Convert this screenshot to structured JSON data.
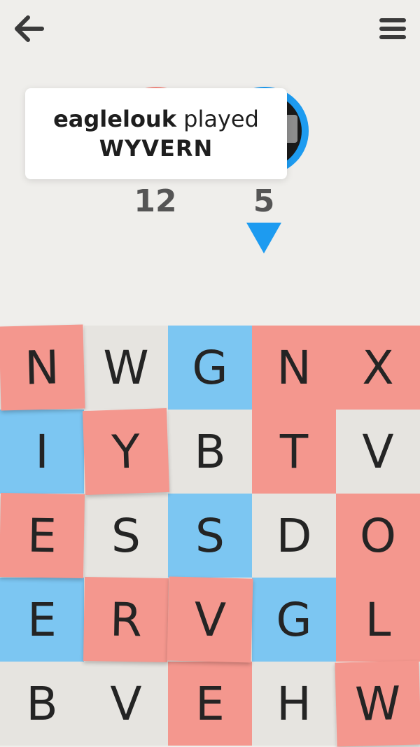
{
  "header": {
    "back_icon": "arrow-left-icon",
    "menu_icon": "hamburger-menu-icon"
  },
  "toast": {
    "player": "eaglelouk",
    "verb": "played",
    "word": "WYVERN"
  },
  "scores": {
    "left": "12",
    "right": "5"
  },
  "colors": {
    "red": "#f4978e",
    "blue": "#7cc6f2",
    "neutral": "#e6e4e0",
    "accent_blue": "#1d9bf0",
    "accent_red": "#f28b82"
  },
  "board": {
    "rows": [
      [
        {
          "letter": "N",
          "owner": "red"
        },
        {
          "letter": "W",
          "owner": "neutral"
        },
        {
          "letter": "G",
          "owner": "blue"
        },
        {
          "letter": "N",
          "owner": "red"
        },
        {
          "letter": "X",
          "owner": "red"
        }
      ],
      [
        {
          "letter": "I",
          "owner": "blue"
        },
        {
          "letter": "Y",
          "owner": "red"
        },
        {
          "letter": "B",
          "owner": "neutral"
        },
        {
          "letter": "T",
          "owner": "red"
        },
        {
          "letter": "V",
          "owner": "neutral"
        }
      ],
      [
        {
          "letter": "E",
          "owner": "red"
        },
        {
          "letter": "S",
          "owner": "neutral"
        },
        {
          "letter": "S",
          "owner": "blue"
        },
        {
          "letter": "D",
          "owner": "neutral"
        },
        {
          "letter": "O",
          "owner": "red"
        }
      ],
      [
        {
          "letter": "E",
          "owner": "blue"
        },
        {
          "letter": "R",
          "owner": "red"
        },
        {
          "letter": "V",
          "owner": "red"
        },
        {
          "letter": "G",
          "owner": "blue"
        },
        {
          "letter": "L",
          "owner": "red"
        }
      ],
      [
        {
          "letter": "B",
          "owner": "neutral"
        },
        {
          "letter": "V",
          "owner": "neutral"
        },
        {
          "letter": "E",
          "owner": "red"
        },
        {
          "letter": "H",
          "owner": "neutral"
        },
        {
          "letter": "W",
          "owner": "red"
        }
      ]
    ]
  }
}
